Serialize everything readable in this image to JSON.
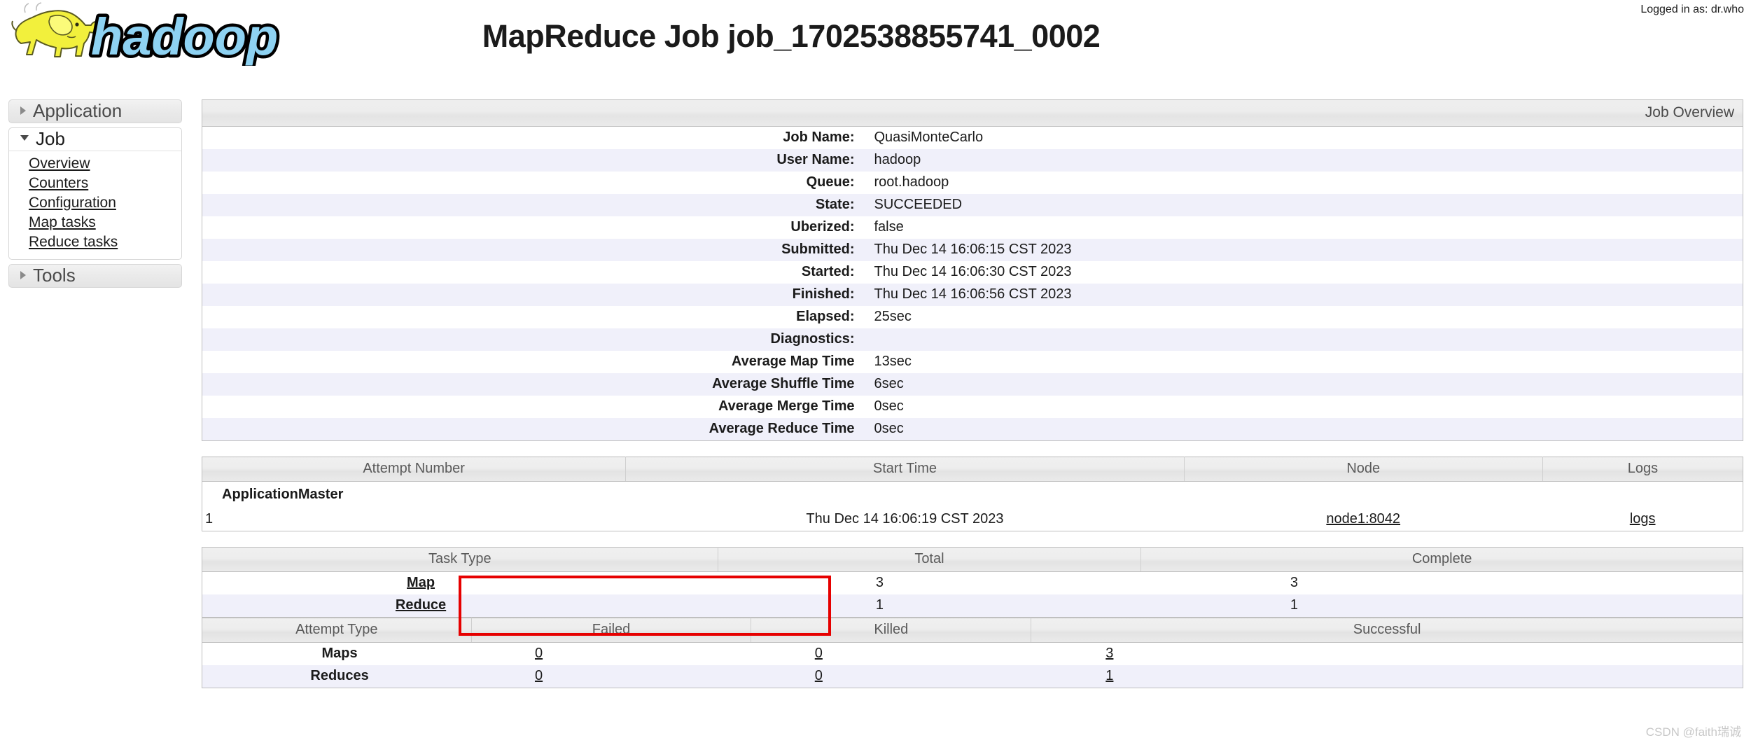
{
  "header": {
    "logo_alt": "hadoop",
    "title": "MapReduce Job job_1702538855741_0002",
    "logged_in": "Logged in as: dr.who"
  },
  "sidebar": {
    "sections": [
      {
        "label": "Application",
        "expanded": false,
        "items": []
      },
      {
        "label": "Job",
        "expanded": true,
        "items": [
          {
            "label": "Overview"
          },
          {
            "label": "Counters"
          },
          {
            "label": "Configuration"
          },
          {
            "label": "Map tasks"
          },
          {
            "label": "Reduce tasks"
          }
        ]
      },
      {
        "label": "Tools",
        "expanded": false,
        "items": []
      }
    ]
  },
  "job_overview": {
    "caption": "Job Overview",
    "rows": [
      {
        "label": "Job Name:",
        "value": "QuasiMonteCarlo"
      },
      {
        "label": "User Name:",
        "value": "hadoop"
      },
      {
        "label": "Queue:",
        "value": "root.hadoop"
      },
      {
        "label": "State:",
        "value": "SUCCEEDED"
      },
      {
        "label": "Uberized:",
        "value": "false"
      },
      {
        "label": "Submitted:",
        "value": "Thu Dec 14 16:06:15 CST 2023"
      },
      {
        "label": "Started:",
        "value": "Thu Dec 14 16:06:30 CST 2023"
      },
      {
        "label": "Finished:",
        "value": "Thu Dec 14 16:06:56 CST 2023"
      },
      {
        "label": "Elapsed:",
        "value": "25sec"
      },
      {
        "label": "Diagnostics:",
        "value": ""
      },
      {
        "label": "Average Map Time",
        "value": "13sec"
      },
      {
        "label": "Average Shuffle Time",
        "value": "6sec"
      },
      {
        "label": "Average Merge Time",
        "value": "0sec"
      },
      {
        "label": "Average Reduce Time",
        "value": "0sec"
      }
    ]
  },
  "application_master": {
    "title": "ApplicationMaster",
    "columns": [
      "Attempt Number",
      "Start Time",
      "Node",
      "Logs"
    ],
    "rows": [
      {
        "attempt_number": "1",
        "start_time": "Thu Dec 14 16:06:19 CST 2023",
        "node": "node1:8042",
        "logs": "logs"
      }
    ]
  },
  "task_summary": {
    "columns": [
      "Task Type",
      "Total",
      "Complete"
    ],
    "rows": [
      {
        "task_type": "Map",
        "total": "3",
        "complete": "3"
      },
      {
        "task_type": "Reduce",
        "total": "1",
        "complete": "1"
      }
    ]
  },
  "attempt_summary": {
    "columns": [
      "Attempt Type",
      "Failed",
      "Killed",
      "Successful"
    ],
    "rows": [
      {
        "attempt_type": "Maps",
        "failed": "0",
        "killed": "0",
        "successful": "3"
      },
      {
        "attempt_type": "Reduces",
        "failed": "0",
        "killed": "0",
        "successful": "1"
      }
    ]
  },
  "annotation": {
    "color": "#e60000",
    "target": "task-type-map-reduce-rows"
  },
  "watermark": "CSDN @faith瑞诚"
}
